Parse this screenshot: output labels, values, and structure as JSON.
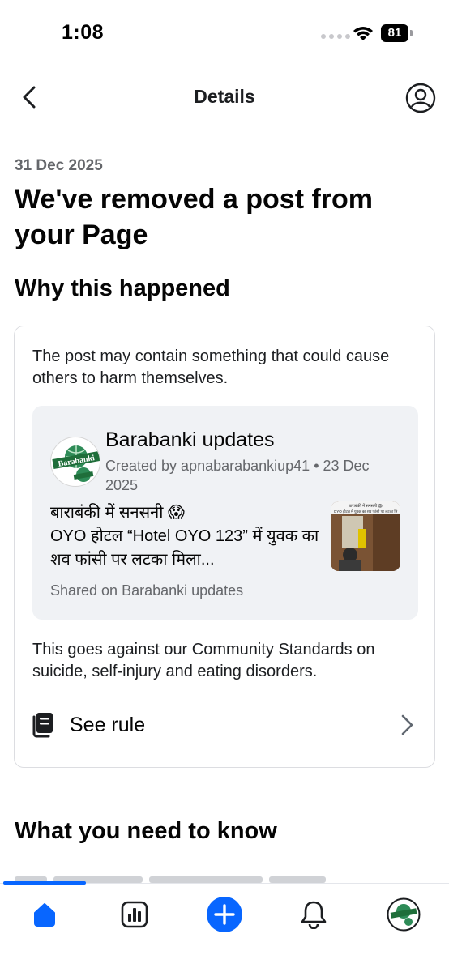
{
  "status_bar": {
    "time": "1:08",
    "battery": "81"
  },
  "header": {
    "title": "Details"
  },
  "notice": {
    "date": "31 Dec 2025",
    "title": "We've removed a post from your Page"
  },
  "why": {
    "heading": "Why this happened",
    "reason": "The post may contain something that could cause others to harm themselves.",
    "post": {
      "page_name": "Barabanki updates",
      "meta": "Created by apnabarabankiup41 • 23 Dec 2025",
      "body_line1": "बाराबंकी में सनसनी 😱",
      "body_line2": "OYO होटल “Hotel OYO 123” में युवक का शव फांसी पर लटका मिला...",
      "thumb_caption": "बाराबंकी में सनसनी 😱",
      "thumb_caption2": "OYO होटल में युवक का शव फांसी पर लटका मि",
      "shared_on": "Shared on Barabanki updates",
      "avatar_text": "Barabanki"
    },
    "standards": "This goes against our Community Standards on suicide, self-injury and eating disorders.",
    "see_rule": "See rule"
  },
  "know": {
    "heading": "What you need to know"
  },
  "colors": {
    "accent": "#0866ff",
    "muted": "#65676b",
    "card_bg": "#f0f2f5"
  },
  "tabs": [
    {
      "icon": "home-icon",
      "active": true
    },
    {
      "icon": "insights-icon",
      "active": false
    },
    {
      "icon": "create-icon",
      "active": false
    },
    {
      "icon": "notifications-icon",
      "active": false
    },
    {
      "icon": "page-avatar",
      "active": false
    }
  ]
}
